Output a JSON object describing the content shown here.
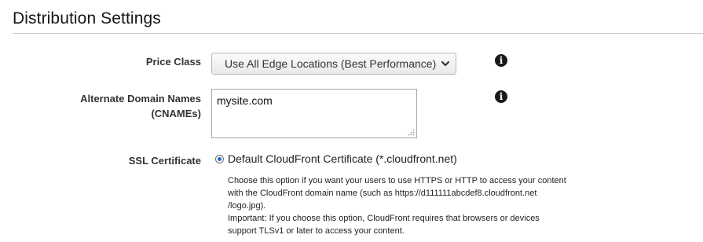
{
  "section": {
    "title": "Distribution Settings"
  },
  "price_class": {
    "label": "Price Class",
    "selected_value": "Use All Edge Locations (Best Performance)",
    "icon": "chevron-down-icon"
  },
  "alternate_domains": {
    "label_line1": "Alternate Domain Names",
    "label_line2": "(CNAMEs)",
    "value": "mysite.com"
  },
  "ssl_certificate": {
    "label": "SSL Certificate",
    "option_label": "Default CloudFront Certificate (*.cloudfront.net)",
    "option_selected": true,
    "help_lines": [
      "Choose this option if you want your users to use HTTPS or HTTP to access your content",
      "with the CloudFront domain name (such as https://d111111abcdef8.cloudfront.net",
      "/logo.jpg).",
      "Important: If you choose this option, CloudFront requires that browsers or devices",
      "support TLSv1 or later to access your content."
    ]
  },
  "info_icon": {
    "glyph": "i",
    "icon": "info-icon"
  },
  "colors": {
    "radio_accent": "#1b6ac9",
    "rule": "#c9c9c9"
  }
}
